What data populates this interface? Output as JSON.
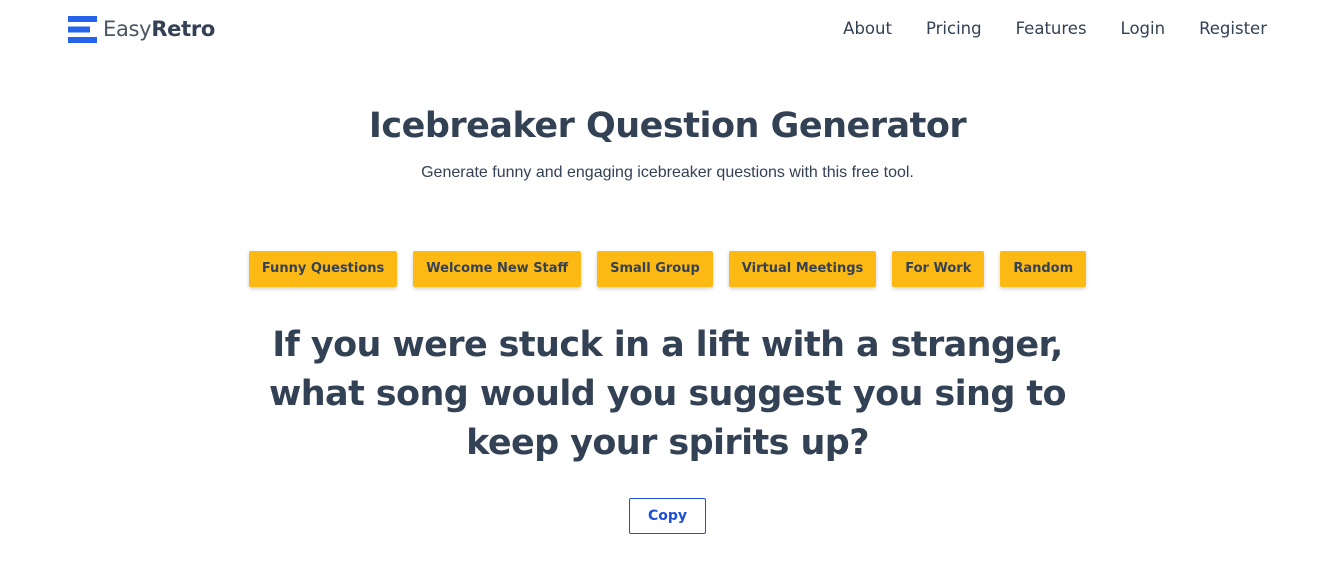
{
  "brand": {
    "name_light": "Easy",
    "name_bold": "Retro",
    "icon": "easyretro-logo-icon",
    "color": "#2563eb"
  },
  "nav": {
    "items": [
      {
        "label": "About"
      },
      {
        "label": "Pricing"
      },
      {
        "label": "Features"
      },
      {
        "label": "Login"
      },
      {
        "label": "Register"
      }
    ]
  },
  "hero": {
    "title": "Icebreaker Question Generator",
    "subtitle": "Generate funny and engaging icebreaker questions with this free tool."
  },
  "categories": {
    "button_color": "#fdb913",
    "items": [
      {
        "label": "Funny Questions"
      },
      {
        "label": "Welcome New Staff"
      },
      {
        "label": "Small Group"
      },
      {
        "label": "Virtual Meetings"
      },
      {
        "label": "For Work"
      },
      {
        "label": "Random"
      }
    ]
  },
  "question": {
    "text": "If you were stuck in a lift with a stranger, what song would you suggest you sing to keep your spirits up?"
  },
  "actions": {
    "copy_label": "Copy",
    "accent": "#1d4ed8"
  }
}
